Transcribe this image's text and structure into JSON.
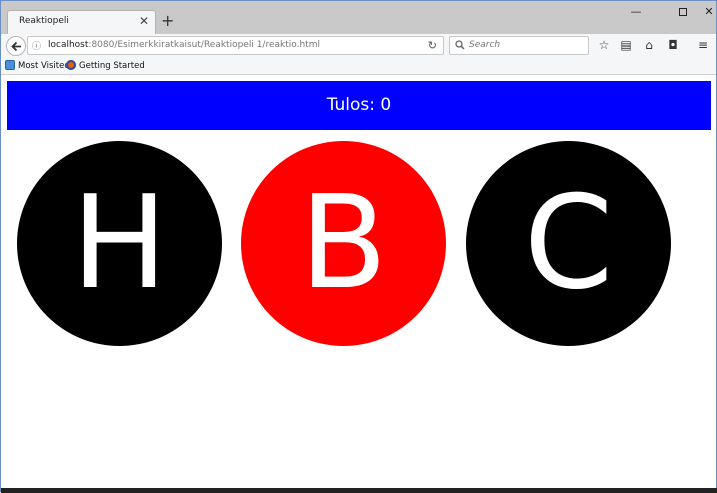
{
  "browser": {
    "tab_title": "Reaktiopeli",
    "tab_close": "✕",
    "new_tab": "+",
    "window_controls": {
      "minimize": "—",
      "maximize": "☐",
      "close": "✕"
    },
    "url_host": "localhost",
    "url_rest": ":8080/Esimerkkiratkaisut/Reaktiopeli 1/reaktio.html",
    "search_placeholder": "Search",
    "bookmarks": [
      {
        "label": "Most Visited",
        "icon": "most-visited-icon"
      },
      {
        "label": "Getting Started",
        "icon": "firefox-icon"
      }
    ]
  },
  "page": {
    "score_label": "Tulos: 0",
    "circles": [
      {
        "letter": "H",
        "color": "#000000"
      },
      {
        "letter": "B",
        "color": "#ff0000"
      },
      {
        "letter": "C",
        "color": "#000000"
      }
    ],
    "colors": {
      "score_bar": "#0000ff",
      "highlight": "#ff0000",
      "default": "#000000"
    }
  }
}
